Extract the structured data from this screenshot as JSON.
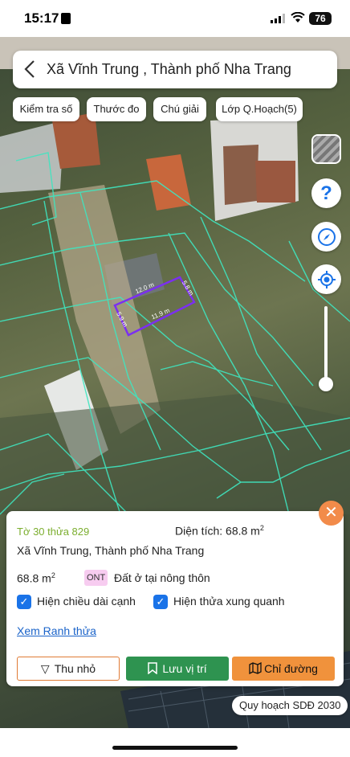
{
  "status_bar": {
    "time": "15:17",
    "battery": "76"
  },
  "header": {
    "title": "Xã Vĩnh Trung , Thành phố Nha Trang"
  },
  "toolbar": {
    "chips": [
      "Kiểm tra số",
      "Thước đo",
      "Chú giải",
      "Lớp Q.Hoạch(5)"
    ]
  },
  "map_controls": {
    "icons": [
      "layer-thumbnail",
      "help-icon",
      "compass-icon",
      "my-location-icon"
    ],
    "help_glyph": "?"
  },
  "parcel_measurements": {
    "top": "12.0 m",
    "right": "5.8 m",
    "left": "5.9 m",
    "bottom": "11.9 m"
  },
  "info_card": {
    "parcel": "Tờ 30 thửa 829",
    "area_label": "Diện tích: 68.8 m",
    "area_sup": "2",
    "location": "Xã Vĩnh Trung, Thành phố Nha Trang",
    "area_value": "68.8 m",
    "area_value_sup": "2",
    "land_code": "ONT",
    "land_use": "Đất ở tại nông thôn",
    "checkbox_1": "Hiện chiều dài cạnh",
    "checkbox_2": "Hiện thửa xung quanh",
    "link": "Xem Ranh thửa",
    "buttons": {
      "minimize": "Thu nhỏ",
      "save": "Lưu vị trí",
      "directions": "Chỉ đường"
    },
    "colors": {
      "accent": "#f28b4a",
      "save": "#2e9350",
      "directions": "#f0923c",
      "link": "#1a63c9"
    }
  },
  "planning_tag": "Quy hoạch SDĐ 2030"
}
